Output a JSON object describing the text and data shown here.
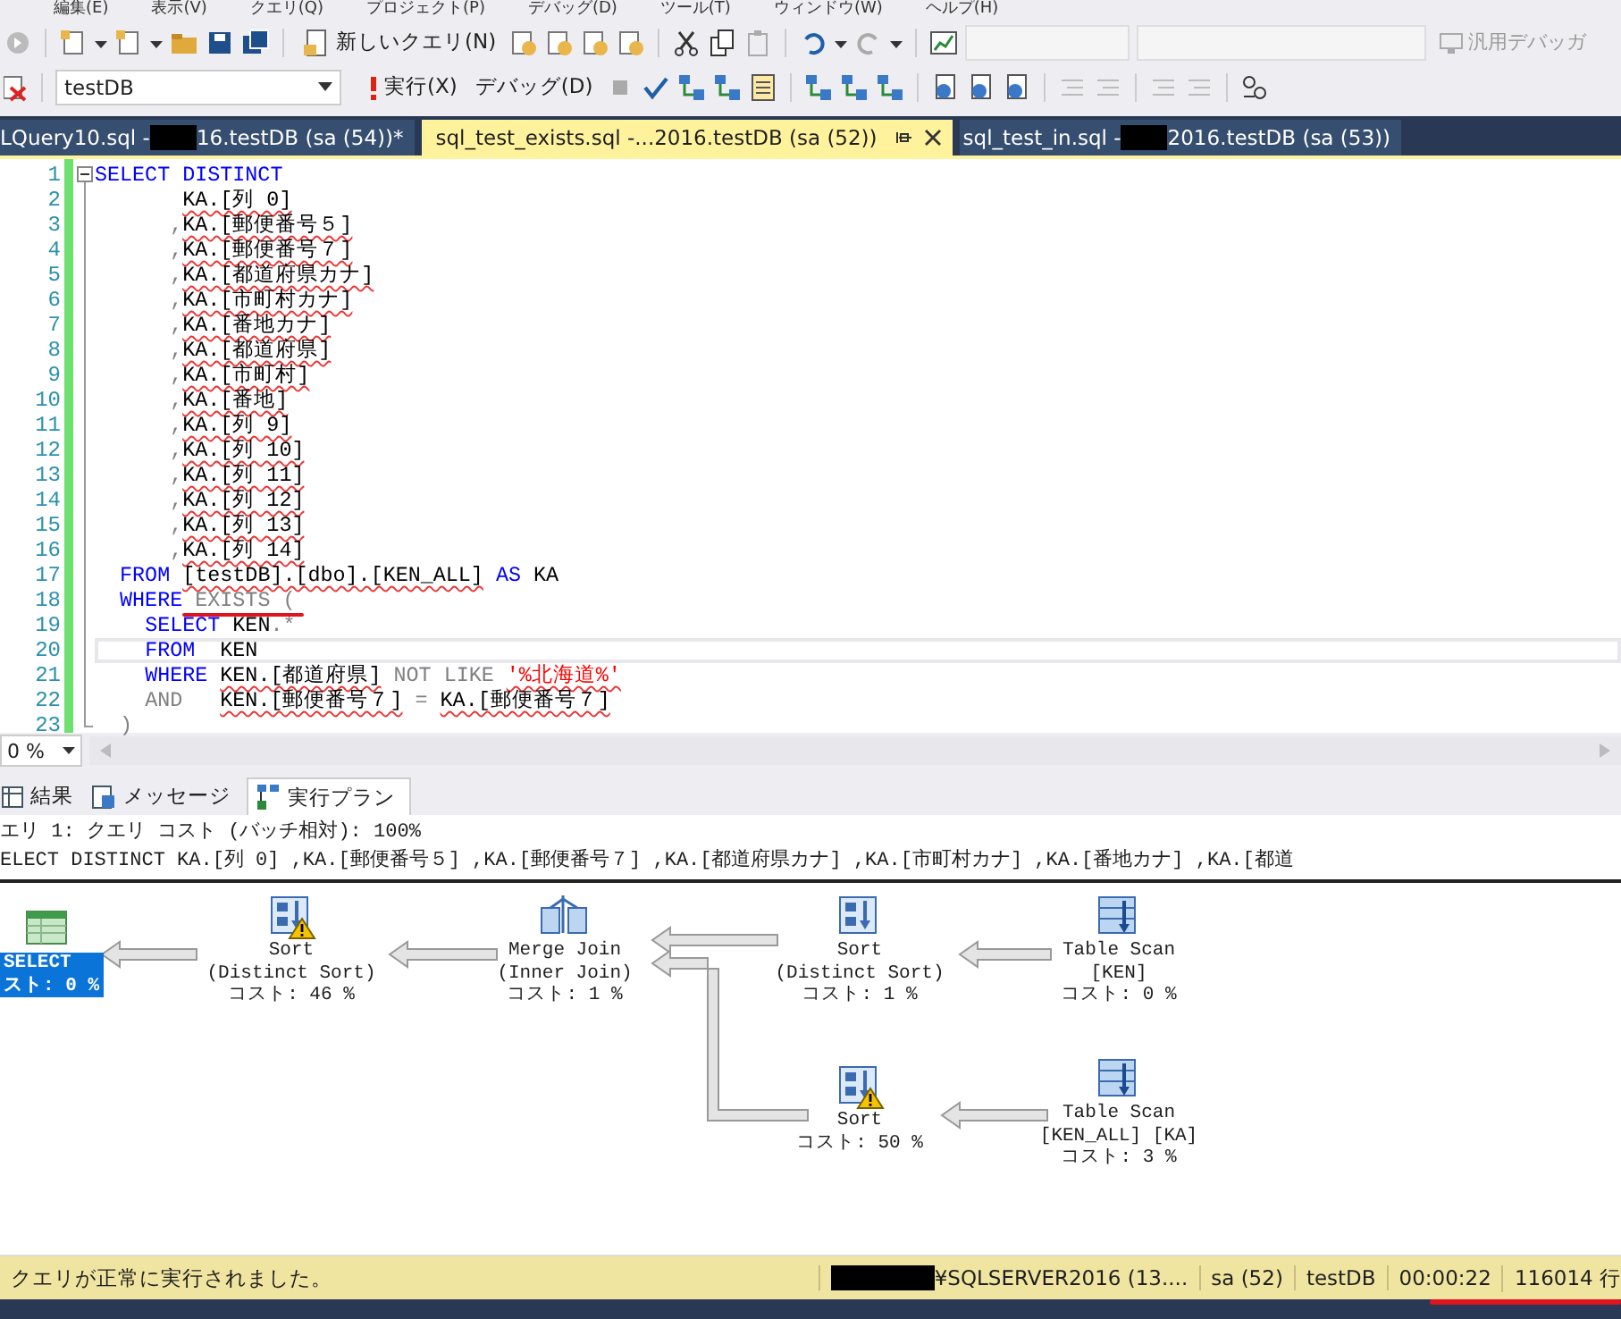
{
  "menu": [
    "編集(E)",
    "表示(V)",
    "クエリ(Q)",
    "プロジェクト(P)",
    "デバッグ(D)",
    "ツール(T)",
    "ウィンドウ(W)",
    "ヘルプ(H)"
  ],
  "toolbar": {
    "new_query": "新しいクエリ(N)",
    "debugger": "汎用デバッガ",
    "database": "testDB",
    "execute": "実行(X)",
    "debug": "デバッグ(D)"
  },
  "doc_tabs": [
    {
      "label_start": "LQuery10.sql - ",
      "label_end": "16.testDB (sa (54))*",
      "selected": false
    },
    {
      "label_start": "sql_test_exists.sql -...2016.testDB (sa (52))",
      "selected": true
    },
    {
      "label_start": "sql_test_in.sql - ",
      "label_end": "2016.testDB (sa (53))",
      "selected": false
    }
  ],
  "editor": {
    "lines": [
      {
        "n": "1",
        "current": false,
        "tokens": [
          {
            "text": "SELECT DISTINCT",
            "kind": "kw"
          }
        ]
      },
      {
        "n": "2",
        "current": false,
        "tokens": [
          {
            "text": "       KA.[列 0]",
            "kind": "id_sq"
          }
        ]
      },
      {
        "n": "3",
        "current": false,
        "tokens": [
          {
            "text": "      ,",
            "kind": "op"
          },
          {
            "text": "KA.[郵便番号５]",
            "kind": "id_sq"
          }
        ]
      },
      {
        "n": "4",
        "current": false,
        "tokens": [
          {
            "text": "      ,",
            "kind": "op"
          },
          {
            "text": "KA.[郵便番号７]",
            "kind": "id_sq"
          }
        ]
      },
      {
        "n": "5",
        "current": false,
        "tokens": [
          {
            "text": "      ,",
            "kind": "op"
          },
          {
            "text": "KA.[都道府県カナ]",
            "kind": "id_sq"
          }
        ]
      },
      {
        "n": "6",
        "current": false,
        "tokens": [
          {
            "text": "      ,",
            "kind": "op"
          },
          {
            "text": "KA.[市町村カナ]",
            "kind": "id_sq"
          }
        ]
      },
      {
        "n": "7",
        "current": false,
        "tokens": [
          {
            "text": "      ,",
            "kind": "op"
          },
          {
            "text": "KA.[番地カナ]",
            "kind": "id_sq"
          }
        ]
      },
      {
        "n": "8",
        "current": false,
        "tokens": [
          {
            "text": "      ,",
            "kind": "op"
          },
          {
            "text": "KA.[都道府県]",
            "kind": "id_sq"
          }
        ]
      },
      {
        "n": "9",
        "current": false,
        "tokens": [
          {
            "text": "      ,",
            "kind": "op"
          },
          {
            "text": "KA.[市町村]",
            "kind": "id_sq"
          }
        ]
      },
      {
        "n": "10",
        "current": false,
        "tokens": [
          {
            "text": "      ,",
            "kind": "op"
          },
          {
            "text": "KA.[番地]",
            "kind": "id_sq"
          }
        ]
      },
      {
        "n": "11",
        "current": false,
        "tokens": [
          {
            "text": "      ,",
            "kind": "op"
          },
          {
            "text": "KA.[列 9]",
            "kind": "id_sq"
          }
        ]
      },
      {
        "n": "12",
        "current": false,
        "tokens": [
          {
            "text": "      ,",
            "kind": "op"
          },
          {
            "text": "KA.[列 10]",
            "kind": "id_sq"
          }
        ]
      },
      {
        "n": "13",
        "current": false,
        "tokens": [
          {
            "text": "      ,",
            "kind": "op"
          },
          {
            "text": "KA.[列 11]",
            "kind": "id_sq"
          }
        ]
      },
      {
        "n": "14",
        "current": false,
        "tokens": [
          {
            "text": "      ,",
            "kind": "op"
          },
          {
            "text": "KA.[列 12]",
            "kind": "id_sq"
          }
        ]
      },
      {
        "n": "15",
        "current": false,
        "tokens": [
          {
            "text": "      ,",
            "kind": "op"
          },
          {
            "text": "KA.[列 13]",
            "kind": "id_sq"
          }
        ]
      },
      {
        "n": "16",
        "current": false,
        "tokens": [
          {
            "text": "      ,",
            "kind": "op"
          },
          {
            "text": "KA.[列 14]",
            "kind": "id_sq"
          }
        ]
      },
      {
        "n": "17",
        "current": false,
        "tokens": [
          {
            "text": "  FROM",
            "kind": "kw"
          },
          {
            "text": " [testDB].[dbo].[KEN_ALL]",
            "kind": "id_sq"
          },
          {
            "text": " AS",
            "kind": "kw"
          },
          {
            "text": " KA",
            "kind": "id"
          }
        ]
      },
      {
        "n": "18",
        "current": false,
        "tokens": [
          {
            "text": "  WHERE",
            "kind": "kw"
          },
          {
            "text": " EXISTS (",
            "kind": "op"
          }
        ]
      },
      {
        "n": "19",
        "current": false,
        "tokens": [
          {
            "text": "    SELECT",
            "kind": "kw"
          },
          {
            "text": " KEN",
            "kind": "id"
          },
          {
            "text": ".*",
            "kind": "op"
          }
        ]
      },
      {
        "n": "20",
        "current": true,
        "tokens": [
          {
            "text": "    FROM",
            "kind": "kw"
          },
          {
            "text": "  KEN",
            "kind": "id"
          }
        ]
      },
      {
        "n": "21",
        "current": false,
        "tokens": [
          {
            "text": "    WHERE",
            "kind": "kw"
          },
          {
            "text": " KEN.[都道府県]",
            "kind": "id_sq"
          },
          {
            "text": " NOT LIKE",
            "kind": "op"
          },
          {
            "text": " '%北海道%'",
            "kind": "str_sq"
          }
        ]
      },
      {
        "n": "22",
        "current": false,
        "tokens": [
          {
            "text": "    AND",
            "kind": "op"
          },
          {
            "text": "   KEN.[郵便番号７]",
            "kind": "id_sq"
          },
          {
            "text": " =",
            "kind": "op"
          },
          {
            "text": " KA.[郵便番号７]",
            "kind": "id_sq"
          }
        ]
      },
      {
        "n": "23",
        "current": false,
        "tokens": [
          {
            "text": "  )",
            "kind": "op"
          }
        ]
      }
    ]
  },
  "zoom": "0 %",
  "result_tabs": [
    {
      "label": "結果",
      "selected": false
    },
    {
      "label": "メッセージ",
      "selected": false
    },
    {
      "label": "実行プラン",
      "selected": true
    }
  ],
  "plan_header": [
    "エリ 1: クエリ コスト (バッチ相対): 100%",
    "ELECT DISTINCT KA.[列 0] ,KA.[郵便番号５] ,KA.[郵便番号７] ,KA.[都道府県カナ] ,KA.[市町村カナ] ,KA.[番地カナ] ,KA.[都道"
  ],
  "plan_nodes": [
    {
      "kind": "select",
      "warning": false,
      "selected": true,
      "lines": [
        "SELECT",
        "スト: 0 %"
      ]
    },
    {
      "kind": "sort",
      "warning": true,
      "selected": false,
      "lines": [
        "Sort",
        "(Distinct Sort)",
        "コスト: 46 %"
      ]
    },
    {
      "kind": "merge",
      "warning": false,
      "selected": false,
      "lines": [
        "Merge Join",
        "(Inner Join)",
        "コスト: 1 %"
      ]
    },
    {
      "kind": "sort",
      "warning": false,
      "selected": false,
      "lines": [
        "Sort",
        "(Distinct Sort)",
        "コスト: 1 %"
      ]
    },
    {
      "kind": "scan",
      "warning": false,
      "selected": false,
      "lines": [
        "Table Scan",
        "[KEN]",
        "コスト: 0 %"
      ]
    },
    {
      "kind": "sort",
      "warning": true,
      "selected": false,
      "lines": [
        "Sort",
        "コスト: 50 %"
      ]
    },
    {
      "kind": "scan",
      "warning": false,
      "selected": false,
      "lines": [
        "Table Scan",
        "[KEN_ALL] [KA]",
        "コスト: 3 %"
      ]
    }
  ],
  "status_bar": {
    "message": "クエリが正常に実行されました。",
    "server": "¥SQLSERVER2016 (13....",
    "user": "sa (52)",
    "database": "testDB",
    "elapsed": "00:00:22",
    "rows": "116014 行"
  }
}
